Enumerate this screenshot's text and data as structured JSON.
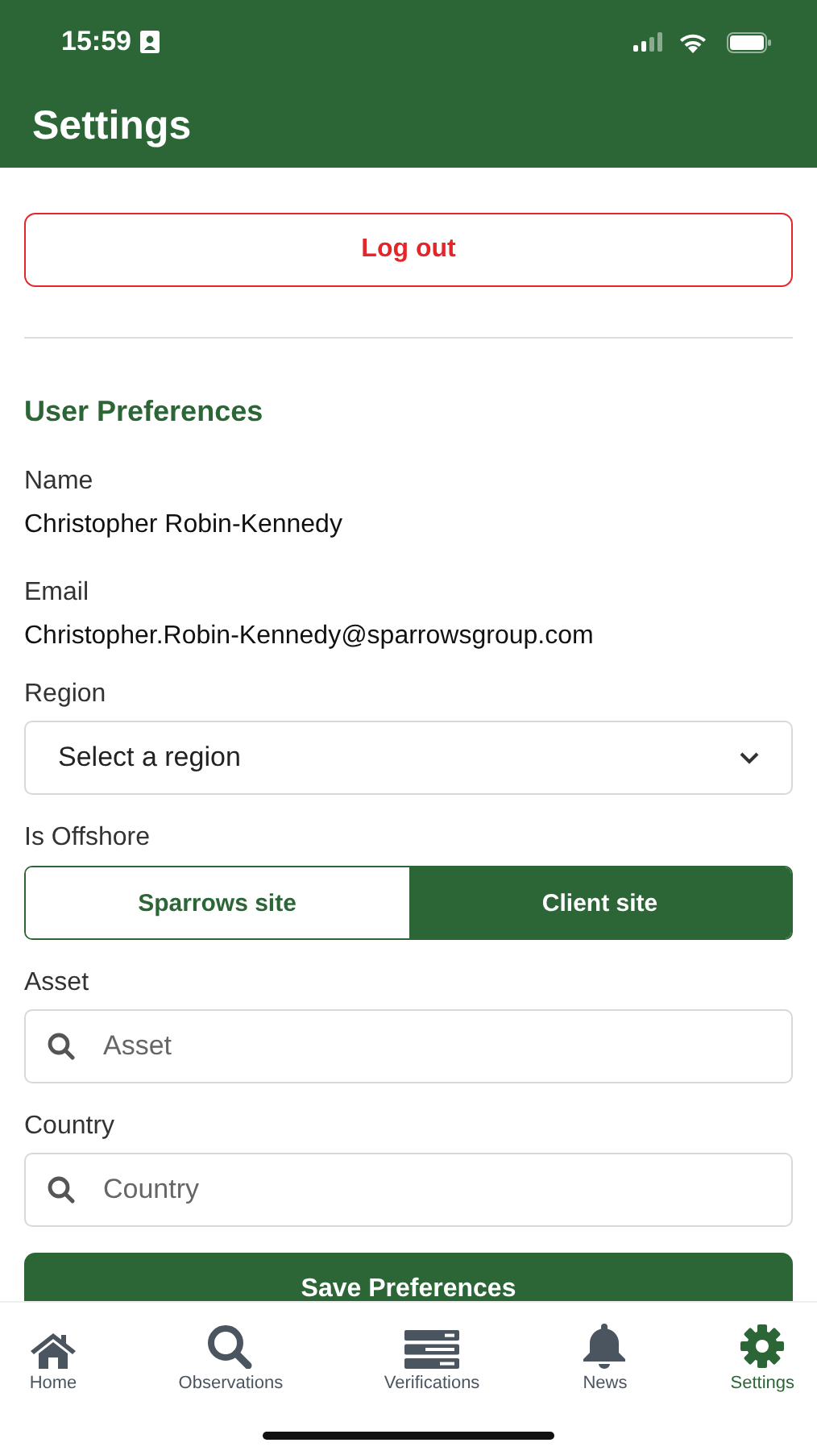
{
  "status_bar": {
    "time": "15:59"
  },
  "header": {
    "title": "Settings"
  },
  "logout_button": "Log out",
  "section_title": "User Preferences",
  "profile": [
    {
      "label": "Name",
      "value": "Christopher Robin-Kennedy"
    },
    {
      "label": "Email",
      "value": "Christopher.Robin-Kennedy@sparrowsgroup.com"
    }
  ],
  "region": {
    "label": "Region",
    "placeholder": "Select a region"
  },
  "offshore": {
    "label": "Is Offshore",
    "options": [
      {
        "label": "Sparrows site",
        "selected": false
      },
      {
        "label": "Client site",
        "selected": true
      }
    ]
  },
  "search_fields": [
    {
      "label": "Asset",
      "placeholder": "Asset"
    },
    {
      "label": "Country",
      "placeholder": "Country"
    }
  ],
  "save_button": "Save Preferences",
  "tab_bar": [
    {
      "kind": "home",
      "label": "Home",
      "selected": false
    },
    {
      "kind": "observations",
      "label": "Observations",
      "selected": false
    },
    {
      "kind": "verifications",
      "label": "Verifications",
      "selected": false
    },
    {
      "kind": "news",
      "label": "News",
      "selected": false
    },
    {
      "kind": "settings",
      "label": "Settings",
      "selected": true
    }
  ]
}
